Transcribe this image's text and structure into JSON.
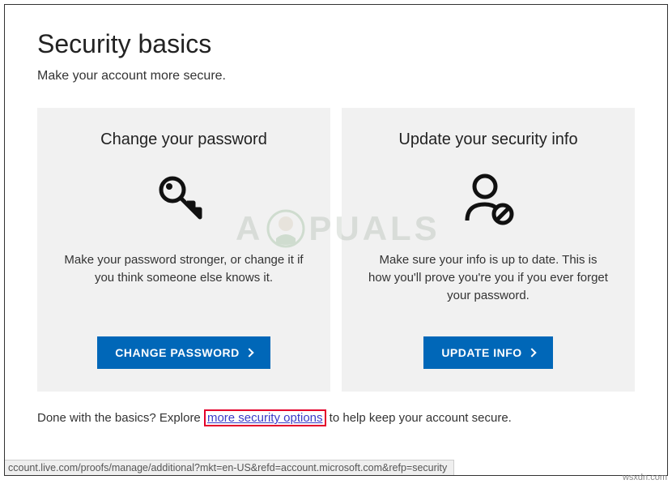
{
  "header": {
    "title": "Security basics",
    "subtitle": "Make your account more secure."
  },
  "cards": {
    "password": {
      "title": "Change your password",
      "desc": "Make your password stronger, or change it if you think someone else knows it.",
      "button": "CHANGE PASSWORD"
    },
    "info": {
      "title": "Update your security info",
      "desc": "Make sure your info is up to date. This is how you'll prove you're you if you ever forget your password.",
      "button": "UPDATE INFO"
    }
  },
  "footer": {
    "prefix": "Done with the basics? Explore ",
    "link": "more security options",
    "suffix": " to help keep your account secure."
  },
  "statusbar": "ccount.live.com/proofs/manage/additional?mkt=en-US&refd=account.microsoft.com&refp=security",
  "watermark": {
    "left": "A",
    "right": "PUALS"
  },
  "credit": "wsxdn.com"
}
